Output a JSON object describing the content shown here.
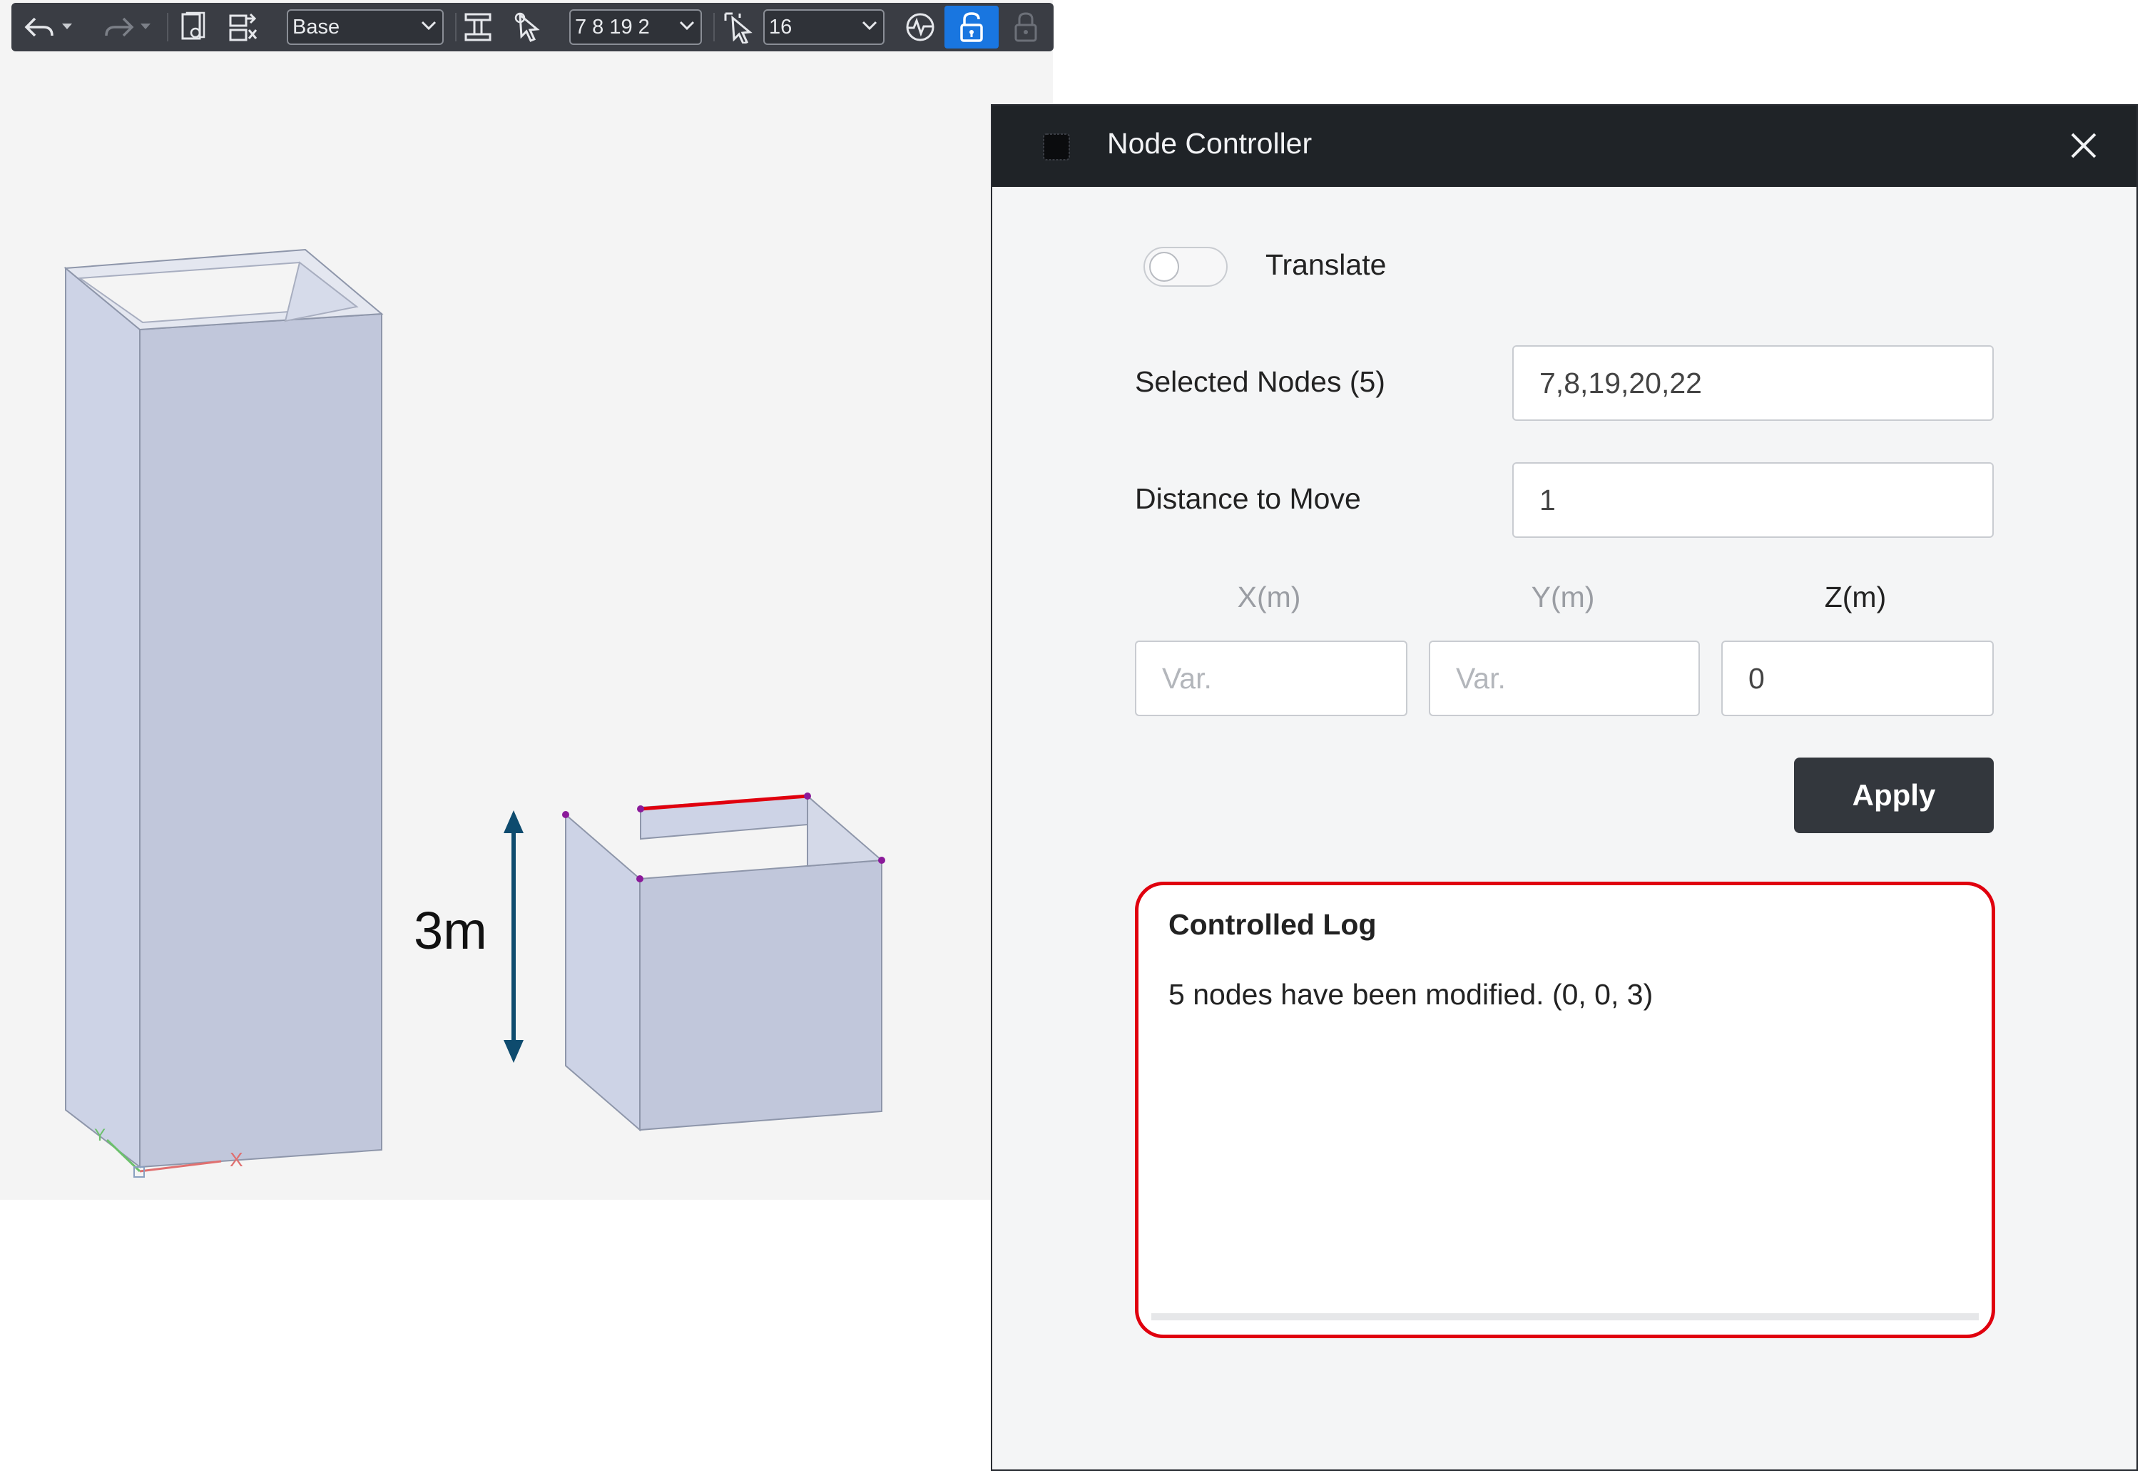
{
  "toolbar": {
    "story_select": "Base",
    "nodes_select": "7 8 19 2",
    "count_select": "16",
    "icons": [
      "undo-icon",
      "redo-icon",
      "page-icon",
      "grid-icon",
      "section-icon",
      "pointer-icon",
      "multi-select-icon",
      "plot-icon",
      "lock-open-icon",
      "lock-icon"
    ]
  },
  "viewport": {
    "dimension_label": "3m",
    "axis_x": "X",
    "axis_y": "Y"
  },
  "dialog": {
    "title": "Node Controller",
    "toggle_label": "Translate",
    "toggle_on": false,
    "selected_nodes_label": "Selected Nodes (5)",
    "selected_nodes_value": "7,8,19,20,22",
    "distance_label": "Distance to Move",
    "distance_value": "1",
    "x_label": "X(m)",
    "y_label": "Y(m)",
    "z_label": "Z(m)",
    "x_placeholder": "Var.",
    "y_placeholder": "Var.",
    "z_value": "0",
    "apply_label": "Apply",
    "log_title": "Controlled Log",
    "log_entries": [
      "5 nodes have been modified. (0, 0, 3)"
    ]
  },
  "colors": {
    "highlight": "#e0000e",
    "arrow": "#0e4b6e",
    "toolbar_bg": "#3a3d44",
    "active_blue": "#1976e0"
  }
}
